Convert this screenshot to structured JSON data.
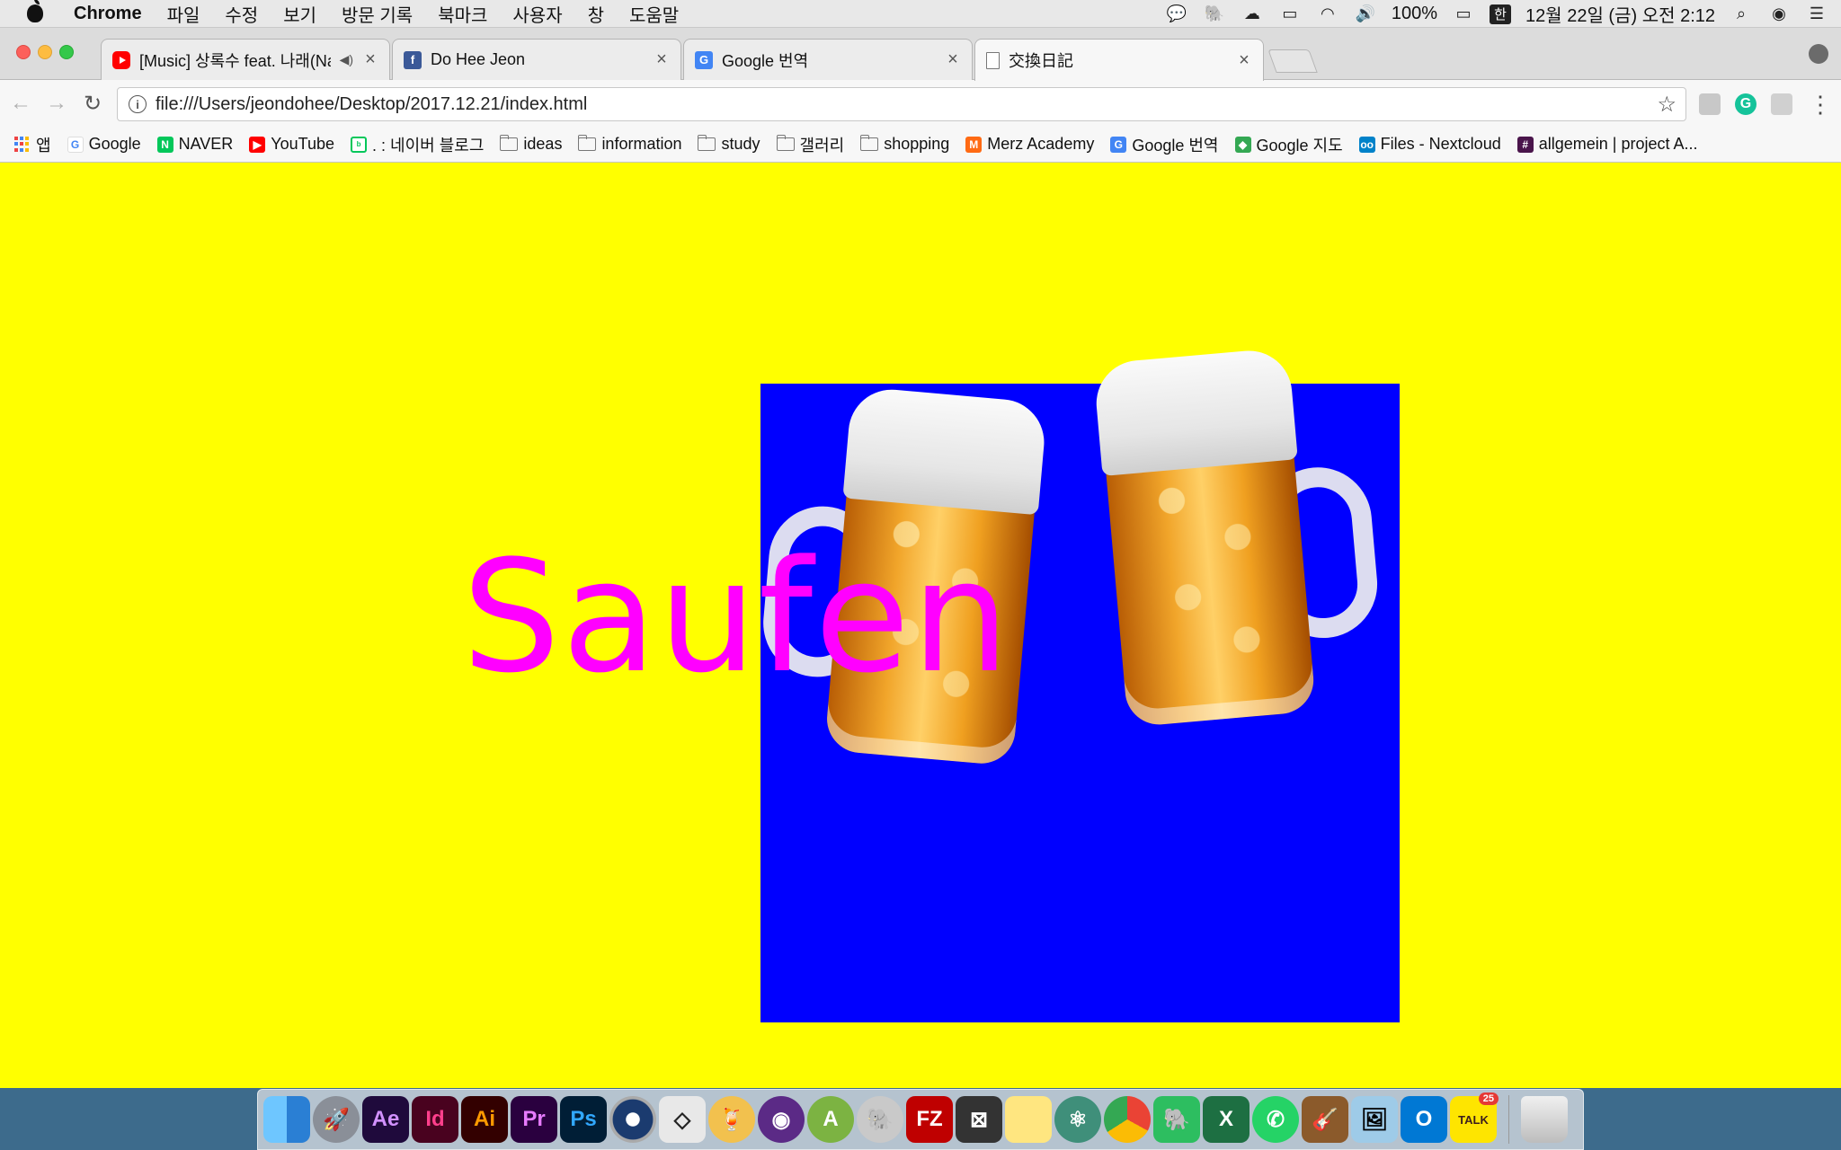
{
  "menubar": {
    "app_name": "Chrome",
    "items": [
      "파일",
      "수정",
      "보기",
      "방문 기록",
      "북마크",
      "사용자",
      "창",
      "도움말"
    ],
    "battery": "100%",
    "input_source": "한",
    "clock": "12월 22일 (금) 오전 2:12"
  },
  "tabs": [
    {
      "title": "[Music] 상록수 feat. 나래(Nar",
      "favicon": "youtube-icon",
      "audio": true
    },
    {
      "title": "Do Hee Jeon",
      "favicon": "facebook-icon"
    },
    {
      "title": "Google 번역",
      "favicon": "google-translate-icon"
    },
    {
      "title": "交換日記",
      "favicon": "document-icon",
      "active": true
    }
  ],
  "toolbar": {
    "url": "file:///Users/jeondohee/Desktop/2017.12.21/index.html"
  },
  "bookmarks": [
    {
      "label": "앱",
      "icon": "apps-grid-icon"
    },
    {
      "label": "Google",
      "icon": "google-icon"
    },
    {
      "label": "NAVER",
      "icon": "naver-icon"
    },
    {
      "label": "YouTube",
      "icon": "youtube-icon"
    },
    {
      "label": ". : 네이버 블로그",
      "icon": "naver-blog-icon"
    },
    {
      "label": "ideas",
      "icon": "folder-icon"
    },
    {
      "label": "information",
      "icon": "folder-icon"
    },
    {
      "label": "study",
      "icon": "folder-icon"
    },
    {
      "label": "갤러리",
      "icon": "folder-icon"
    },
    {
      "label": "shopping",
      "icon": "folder-icon"
    },
    {
      "label": "Merz Academy",
      "icon": "merz-icon"
    },
    {
      "label": "Google 번역",
      "icon": "google-translate-icon"
    },
    {
      "label": "Google 지도",
      "icon": "google-maps-icon"
    },
    {
      "label": "Files - Nextcloud",
      "icon": "nextcloud-icon"
    },
    {
      "label": "allgemein | project A...",
      "icon": "slack-icon"
    }
  ],
  "page": {
    "headline": "Saufen",
    "background_color": "#ffff00",
    "box_color": "#0000ff",
    "text_color": "#ff00ff"
  },
  "dock": {
    "apps": [
      {
        "name": "finder-icon",
        "label": ""
      },
      {
        "name": "launchpad-icon",
        "label": ""
      },
      {
        "name": "after-effects-icon",
        "label": "Ae"
      },
      {
        "name": "indesign-icon",
        "label": "Id"
      },
      {
        "name": "illustrator-icon",
        "label": "Ai"
      },
      {
        "name": "premiere-icon",
        "label": "Pr"
      },
      {
        "name": "photoshop-icon",
        "label": "Ps"
      },
      {
        "name": "cinema4d-icon",
        "label": ""
      },
      {
        "name": "unity-icon",
        "label": ""
      },
      {
        "name": "cocktail-icon",
        "label": ""
      },
      {
        "name": "github-icon",
        "label": ""
      },
      {
        "name": "android-studio-icon",
        "label": ""
      },
      {
        "name": "sequel-pro-icon",
        "label": ""
      },
      {
        "name": "filezilla-icon",
        "label": "FZ"
      },
      {
        "name": "processing-icon",
        "label": ""
      },
      {
        "name": "notes-icon",
        "label": ""
      },
      {
        "name": "atom-icon",
        "label": ""
      },
      {
        "name": "chrome-icon",
        "label": ""
      },
      {
        "name": "evernote-icon",
        "label": ""
      },
      {
        "name": "excel-icon",
        "label": "X"
      },
      {
        "name": "whatsapp-icon",
        "label": ""
      },
      {
        "name": "guitar-icon",
        "label": ""
      },
      {
        "name": "preview-icon",
        "label": ""
      },
      {
        "name": "outlook-icon",
        "label": "O"
      },
      {
        "name": "kakaotalk-icon",
        "label": "TALK",
        "badge": "25"
      },
      {
        "name": "trash-icon",
        "label": ""
      }
    ]
  }
}
